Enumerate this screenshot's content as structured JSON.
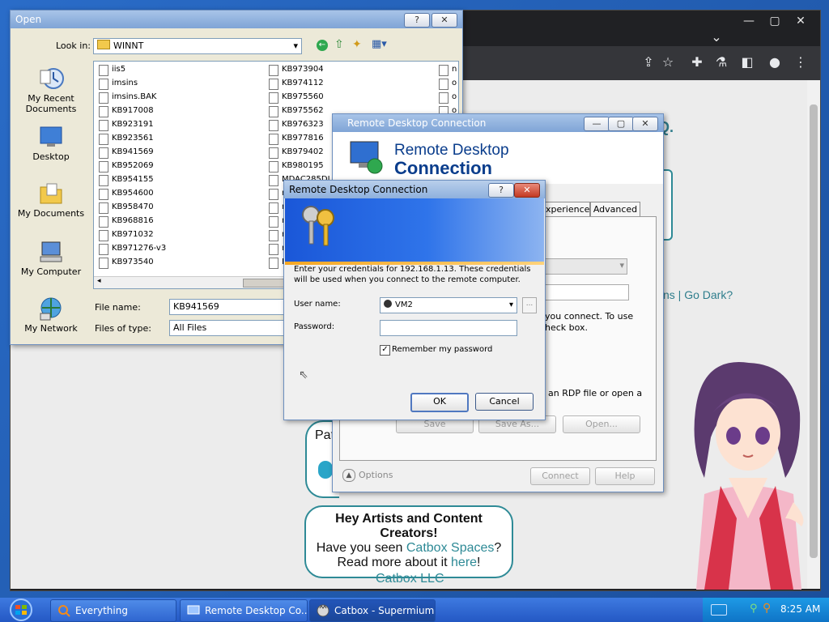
{
  "browser": {
    "window_buttons": [
      "—",
      "▢",
      "✕"
    ],
    "chevron": "⌄",
    "toolbar_icons": [
      "share-icon",
      "star-icon",
      "extensions-icon",
      "lab-icon",
      "sidebar-icon",
      "profile-icon",
      "menu-icon"
    ],
    "site": {
      "title_fragment": "Q.",
      "nav_right": "ns | Go Dark?",
      "patron_fragment": "Pat",
      "promo": {
        "heading": "Hey Artists and Content Creators!",
        "line1_prefix": "Have you seen ",
        "line1_link": "Catbox Spaces",
        "line1_suffix": "?",
        "line2_prefix": "Read more about it ",
        "line2_link": "here",
        "line2_suffix": "!"
      },
      "footer": "Catbox LLC"
    }
  },
  "open_dialog": {
    "title": "Open",
    "look_in_label": "Look in:",
    "look_in_value": "WINNT",
    "places": [
      "My Recent Documents",
      "Desktop",
      "My Documents",
      "My Computer",
      "My Network"
    ],
    "files_col1": [
      "iis5",
      "imsins",
      "imsins.BAK",
      "KB917008",
      "KB923191",
      "KB923561",
      "KB941569",
      "KB952069",
      "KB954155",
      "KB954600",
      "KB958470",
      "KB968816",
      "KB971032",
      "KB971276-v3",
      "KB973540"
    ],
    "files_col2": [
      "KB973904",
      "KB974112",
      "KB975560",
      "KB975562",
      "KB976323",
      "KB977816",
      "KB979402",
      "KB980195",
      "MDAC285DI",
      "m",
      "m",
      "m",
      "m",
      "m",
      "M"
    ],
    "files_col3": [
      "n",
      "o",
      "o",
      "o"
    ],
    "file_name_label": "File name:",
    "file_name_value": "KB941569",
    "file_type_label": "Files of type:",
    "file_type_value": "All Files"
  },
  "rdc_main": {
    "title": "Remote Desktop Connection",
    "banner_line1": "Remote Desktop",
    "banner_line2": "Connection",
    "tabs": [
      "xperience",
      "Advanced"
    ],
    "text_connect": "you connect. To use",
    "text_checkbox": "heck box.",
    "text_rdp": "an RDP file or open a",
    "save": "Save",
    "save_as": "Save As...",
    "open": "Open...",
    "options": "Options",
    "connect": "Connect",
    "help": "Help"
  },
  "cred_dialog": {
    "title": "Remote Desktop Connection",
    "help": "?",
    "close": "✕",
    "message": "Enter your credentials for 192.168.1.13. These credentials will be used when you connect to the remote computer.",
    "user_label": "User name:",
    "user_value": "VM2",
    "password_label": "Password:",
    "remember_label": "Remember my password",
    "remember_checked": true,
    "ok": "OK",
    "cancel": "Cancel"
  },
  "taskbar": {
    "items": [
      "Everything",
      "Remote Desktop Co...",
      "Catbox - Supermium"
    ],
    "clock": "8:25 AM"
  }
}
